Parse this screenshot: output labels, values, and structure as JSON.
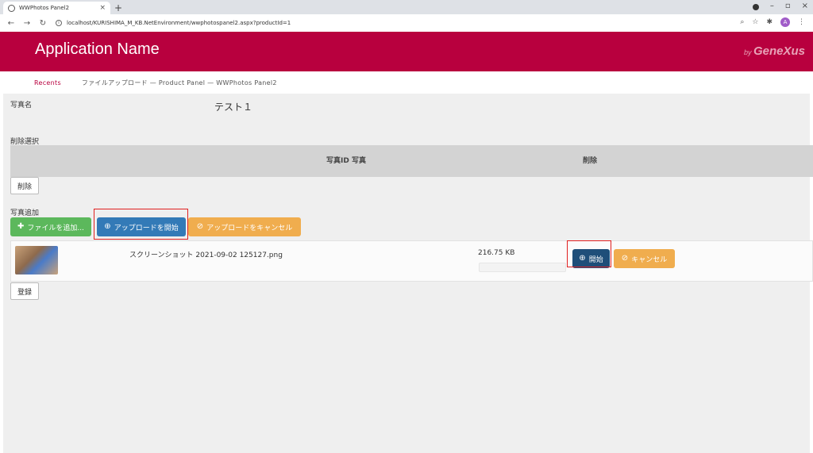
{
  "browser": {
    "tab_title": "WWPhotos Panel2",
    "url": "localhost/KURISHIMA_M_KB.NetEnvironment/wwphotospanel2.aspx?productId=1",
    "profile_initial": "A"
  },
  "header": {
    "app_name": "Application Name",
    "brand_by": "by",
    "brand_name": "GeneXus"
  },
  "breadcrumb": {
    "recents": "Recents",
    "path": "ファイルアップロード — Product Panel — WWPhotos Panel2"
  },
  "form": {
    "photo_name_label": "写真名",
    "photo_name_value": "テスト１",
    "delete_select_label": "削除選択",
    "grid_headers": [
      "写真ID 写真",
      "削除"
    ],
    "delete_button": "削除",
    "add_photo_label": "写真追加",
    "add_file_button": "ファイルを追加...",
    "start_upload_button": "アップロードを開始",
    "cancel_upload_button": "アップロードをキャンセル",
    "register_button": "登録"
  },
  "upload_queue": [
    {
      "filename": "スクリーンショット 2021-09-02 125127.png",
      "size": "216.75 KB",
      "progress": 0,
      "start_button": "開始",
      "cancel_button": "キャンセル"
    }
  ],
  "colors": {
    "brand": "#b8003e",
    "green": "#5cb85c",
    "blue": "#337ab7",
    "orange": "#f0ad4e",
    "highlight": "#e02020"
  },
  "icons": {
    "add": "plus-icon",
    "upload": "upload-circle-icon",
    "cancel": "ban-icon"
  }
}
